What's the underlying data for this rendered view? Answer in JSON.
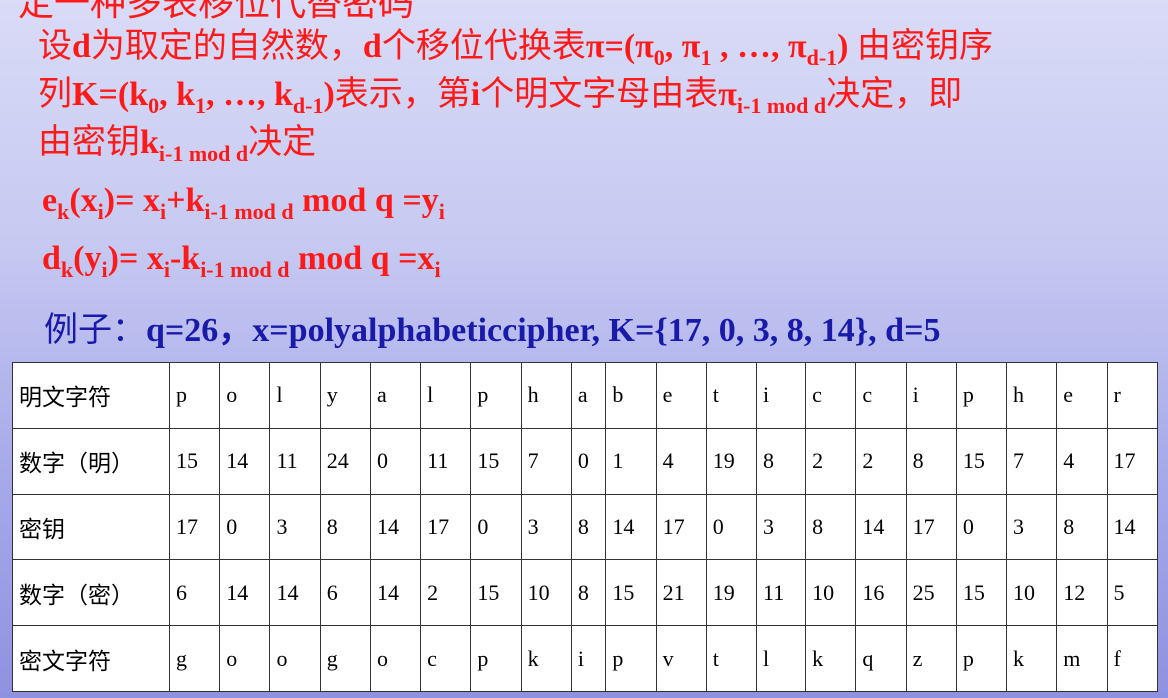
{
  "heading_cut": "定一种多表移位代替密码",
  "paragraph": {
    "line1": "设d为取定的自然数，d个移位代换表π=(π0, π1 , …, πd-1) 由密钥序",
    "line2": "列K=(k0, k1, …, kd-1)表示，第i个明文字母由表πi-1 mod d决定，即",
    "line3": "由密钥ki-1 mod d决定"
  },
  "formulas": {
    "encrypt": "ek(xi)= xi+ki-1 mod d mod q =yi",
    "decrypt": "dk(yi)= xi-ki-1 mod d mod q =xi"
  },
  "example": {
    "prefix": "例子：",
    "text": "q=26，x=polyalphabeticcipher, K={17, 0, 3, 8, 14}, d=5"
  },
  "table": {
    "rows": [
      {
        "label": "明文字符",
        "cells": [
          "p",
          "o",
          "l",
          "y",
          "a",
          "l",
          "p",
          "h",
          "a",
          "b",
          "e",
          "t",
          "i",
          "c",
          "c",
          "i",
          "p",
          "h",
          "e",
          "r"
        ]
      },
      {
        "label": "数字（明）",
        "cells": [
          "15",
          "14",
          "11",
          "24",
          "0",
          "11",
          "15",
          "7",
          "0",
          "1",
          "4",
          "19",
          "8",
          "2",
          "2",
          "8",
          "15",
          "7",
          "4",
          "17"
        ]
      },
      {
        "label": "密钥",
        "cells": [
          "17",
          "0",
          "3",
          "8",
          "14",
          "17",
          "0",
          "3",
          "8",
          "14",
          "17",
          "0",
          "3",
          "8",
          "14",
          "17",
          "0",
          "3",
          "8",
          "14"
        ]
      },
      {
        "label": "数字（密）",
        "cells": [
          "6",
          "14",
          "14",
          "6",
          "14",
          "2",
          "15",
          "10",
          "8",
          "15",
          "21",
          "19",
          "11",
          "10",
          "16",
          "25",
          "15",
          "10",
          "12",
          "5"
        ]
      },
      {
        "label": "密文字符",
        "cells": [
          "g",
          "o",
          "o",
          "g",
          "o",
          "c",
          "p",
          "k",
          "i",
          "p",
          "v",
          "t",
          "l",
          "k",
          "q",
          "z",
          "p",
          "k",
          "m",
          "f"
        ]
      }
    ]
  },
  "colors": {
    "red": "#ff1a1a",
    "blue": "#1a1aa8"
  }
}
